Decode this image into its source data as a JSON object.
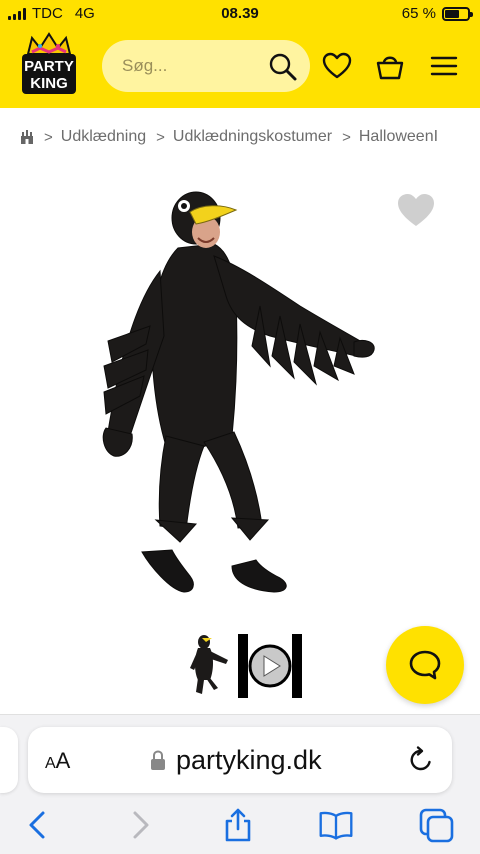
{
  "status_bar": {
    "carrier": "TDC",
    "network": "4G",
    "time": "08.39",
    "battery_percent": "65 %",
    "battery_level": 0.65
  },
  "header": {
    "logo_text_top": "PARTY",
    "logo_text_bottom": "KING",
    "search_placeholder": "Søg...",
    "icons": [
      "search-icon",
      "heart-icon",
      "basket-icon",
      "menu-icon"
    ]
  },
  "breadcrumb": {
    "items": [
      "Udklædning",
      "Udklædningskostumer",
      "HalloweenI"
    ]
  },
  "product": {
    "image_description_icon": "crow-costume-image",
    "favorite_icon": "heart-icon",
    "thumbnails": [
      "thumbnail-costume",
      "thumbnail-video"
    ]
  },
  "chat": {
    "icon": "chat-bubble-icon"
  },
  "safari": {
    "text_size_label_small": "A",
    "text_size_label_large": "A",
    "domain": "partyking.dk",
    "toolbar": [
      "back-icon",
      "forward-icon",
      "share-icon",
      "bookmarks-icon",
      "tabs-icon"
    ]
  },
  "colors": {
    "brand_yellow": "#ffe100",
    "search_bg": "#fff4a0",
    "ios_blue": "#1a6fe0"
  }
}
